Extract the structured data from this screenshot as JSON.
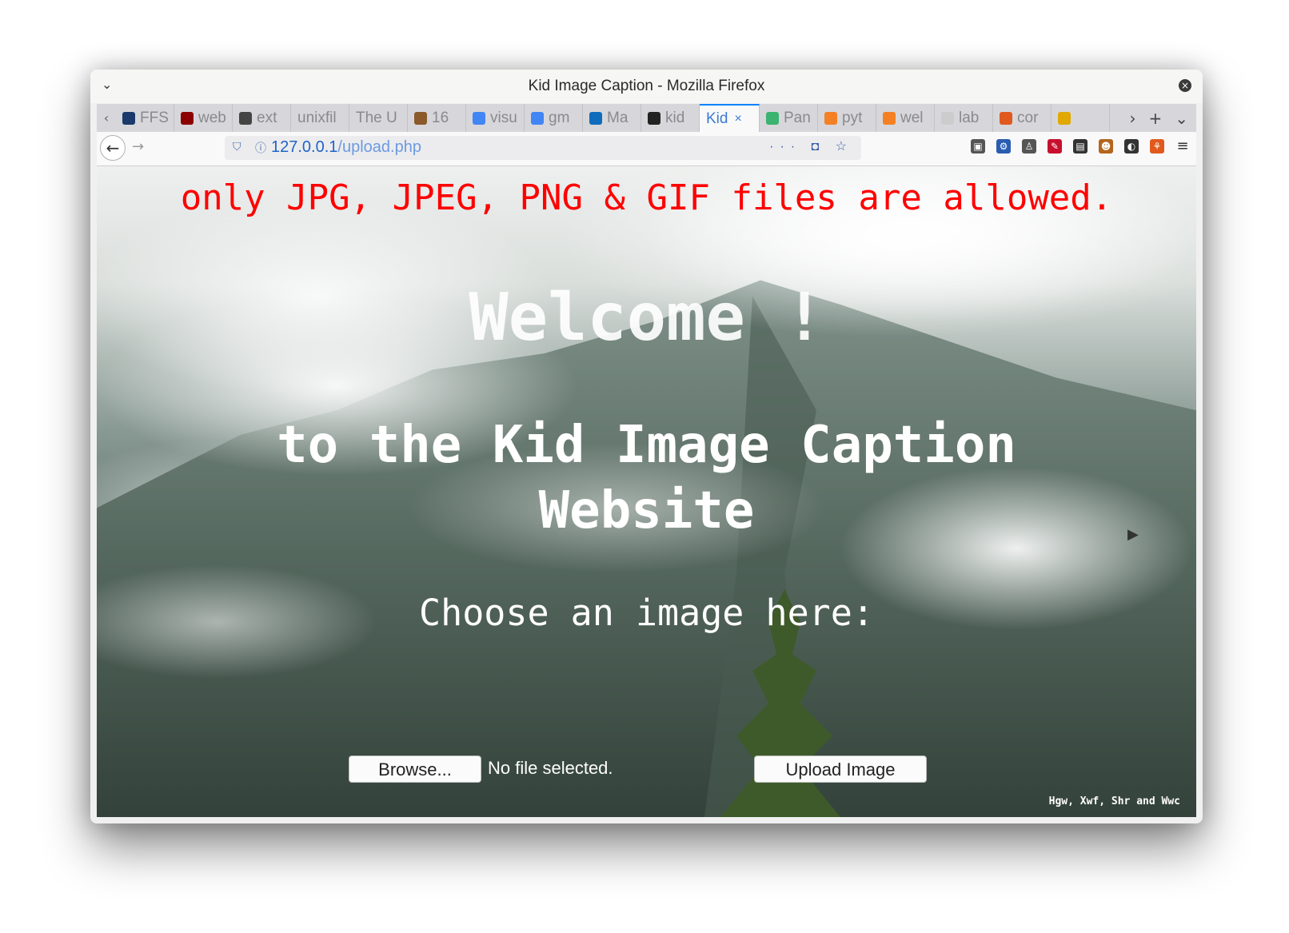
{
  "window": {
    "title": "Kid Image Caption - Mozilla Firefox",
    "menu_chevron": "⌄",
    "close_glyph": "×"
  },
  "tabs": [
    {
      "label": "FFS",
      "icon": "ffs-favicon-icon",
      "color": "#1b3a6b"
    },
    {
      "label": "web",
      "icon": "cs-favicon-icon",
      "color": "#8b0000"
    },
    {
      "label": "ext",
      "icon": "wikipedia-icon",
      "color": "#444444"
    },
    {
      "label": "unixfil",
      "icon": "",
      "color": ""
    },
    {
      "label": "The U",
      "icon": "",
      "color": ""
    },
    {
      "label": "16",
      "icon": "book-favicon-icon",
      "color": "#8a5a2b"
    },
    {
      "label": "visu",
      "icon": "google-icon",
      "color": "#4285f4"
    },
    {
      "label": "gm",
      "icon": "google-icon",
      "color": "#4285f4"
    },
    {
      "label": "Ma",
      "icon": "outlook-icon",
      "color": "#0f6cbd"
    },
    {
      "label": "kid",
      "icon": "github-icon",
      "color": "#222222"
    },
    {
      "label": "Kid",
      "icon": "",
      "color": "",
      "active": true
    },
    {
      "label": "Pan",
      "icon": "loading-icon",
      "color": "#3cb371"
    },
    {
      "label": "pyt",
      "icon": "stackoverflow-icon",
      "color": "#f48024"
    },
    {
      "label": "wel",
      "icon": "stackoverflow-icon",
      "color": "#f48024"
    },
    {
      "label": "lab",
      "icon": "cube-icon",
      "color": "#cccccc"
    },
    {
      "label": "cor",
      "icon": "ask-icon",
      "color": "#e05a1e"
    },
    {
      "label": "",
      "icon": "headphones-icon",
      "color": "#e0a800"
    }
  ],
  "tab_actions": {
    "scroll_right": "›",
    "new_tab": "+",
    "list_all": "⌄",
    "scroll_left": "‹",
    "active_close": "×"
  },
  "nav": {
    "back": "←",
    "forward": "→",
    "url_host": "127.0.0.1",
    "url_path": "/upload.php",
    "page_actions": "··· ◘ ☆"
  },
  "extensions": [
    {
      "name": "screenshot-icon",
      "color": "#555555",
      "glyph": "▣"
    },
    {
      "name": "extension-gear-icon",
      "color": "#2a5db0",
      "glyph": "⚙"
    },
    {
      "name": "person-icon",
      "color": "#555555",
      "glyph": "♙"
    },
    {
      "name": "pdf-icon",
      "color": "#c8102e",
      "glyph": "✎"
    },
    {
      "name": "lock-icon",
      "color": "#333333",
      "glyph": "▤"
    },
    {
      "name": "monkey-icon",
      "color": "#b5651d",
      "glyph": "☻"
    },
    {
      "name": "dark-reader-icon",
      "color": "#333333",
      "glyph": "◐"
    },
    {
      "name": "tree-icon",
      "color": "#e05a1e",
      "glyph": "⚘"
    },
    {
      "name": "menu-icon",
      "color": "#333333",
      "glyph": "≡"
    }
  ],
  "page": {
    "warning": "only JPG, JPEG, PNG & GIF files are allowed.",
    "welcome": "Welcome !",
    "subtitle": "to the Kid Image Caption Website",
    "choose": "Choose an image here:",
    "browse_label": "Browse...",
    "file_status": "No file selected.",
    "upload_label": "Upload Image",
    "credits": "Hgw, Xwf, Shr and Wwc"
  },
  "colors": {
    "warning": "#ff0000",
    "accent": "#0a84ff"
  }
}
